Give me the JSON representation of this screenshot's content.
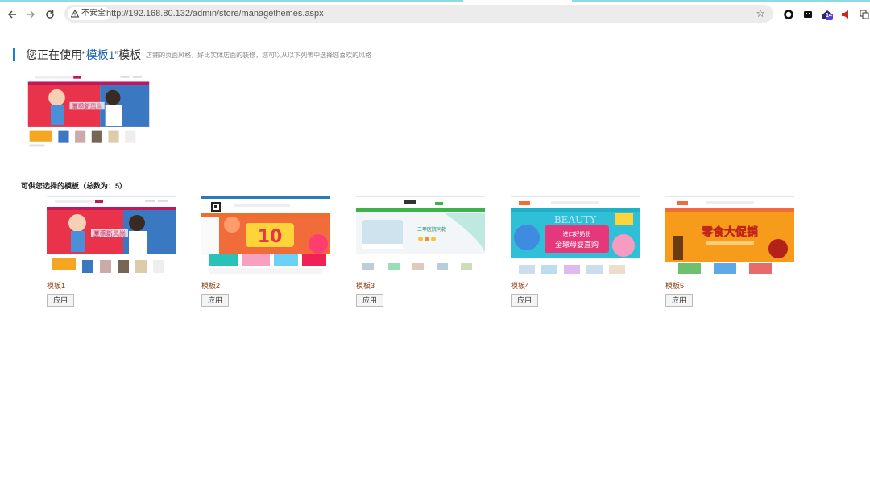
{
  "browser": {
    "insecure_label": "不安全",
    "url": "http://192.168.80.132/admin/store/managethemes.aspx",
    "badge_count": "14"
  },
  "page": {
    "heading_prefix": "您正在使用“",
    "current_theme_name": "模板1",
    "heading_suffix": "”模板",
    "heading_description": "店铺的页面风格，好比实体店面的装修，您可以从以下列表中选择您喜欢的风格",
    "available_title": "可供您选择的模板（总数为：5）",
    "themes": [
      {
        "name": "模板1",
        "apply_label": "应用",
        "banner_text": "夏季新风尚"
      },
      {
        "name": "模板2",
        "apply_label": "应用",
        "banner_text": "10"
      },
      {
        "name": "模板3",
        "apply_label": "应用",
        "banner_text": "三甲医院同款"
      },
      {
        "name": "模板4",
        "apply_label": "应用",
        "banner_text": "全球母婴直购",
        "banner_sub": "进口好奶粉",
        "banner_bg_text": "BEAUTY"
      },
      {
        "name": "模板5",
        "apply_label": "应用",
        "banner_text": "零食大促销"
      }
    ]
  },
  "colors": {
    "accent": "#1a7fd4",
    "theme_name": "#8a3a0c",
    "link_name": "#1a63b5"
  }
}
